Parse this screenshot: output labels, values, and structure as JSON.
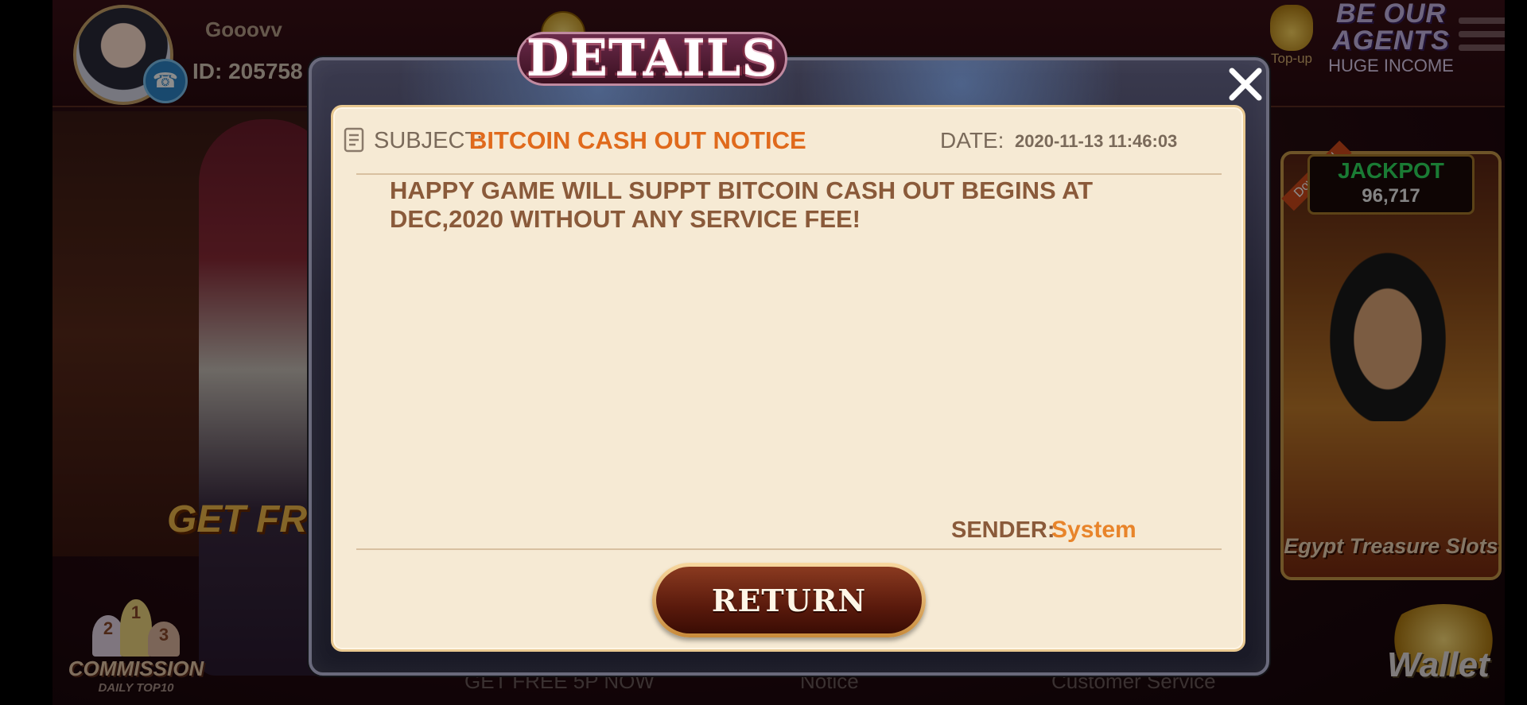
{
  "lobby": {
    "username": "Gooovv",
    "user_id": "ID: 205758",
    "topup_label": "Top-up",
    "agents_line1": "BE OUR",
    "agents_line2": "AGENTS",
    "agents_subtitle": "HUGE INCOME",
    "get_free_text": "GET FRE",
    "commission_label": "COMMISSION",
    "commission_sub": "DAILY TOP10",
    "podium_ranks": [
      "2",
      "1",
      "3"
    ],
    "jackpot_label": "JACKPOT",
    "jackpot_value": "96,717",
    "download_ribbon": "Download",
    "game_title": "Egypt Treasure Slots",
    "wallet_label": "Wallet",
    "bottom_links": [
      "GET FREE 5P NOW",
      "Notice",
      "Customer Service"
    ]
  },
  "dialog": {
    "title": "DETAILS",
    "subject_label": "SUBJECT:",
    "subject_value": "BITCOIN CASH OUT NOTICE",
    "date_label": "DATE:",
    "date_value": "2020-11-13 11:46:03",
    "message": "HAPPY GAME WILL SUPPT BITCOIN CASH OUT BEGINS AT\nDEC,2020 WITHOUT ANY SERVICE FEE!",
    "sender_label": "SENDER:",
    "sender_value": "System",
    "return_label": "RETURN"
  },
  "colors": {
    "accent_orange": "#e06a1c",
    "panel_bg": "#f6ead4",
    "text_brown": "#8a5a3a",
    "jackpot_green": "#30e060"
  },
  "icons": [
    "phone-icon",
    "document-icon",
    "close-icon",
    "menu-icon",
    "coin-icon",
    "money-bag-icon"
  ]
}
